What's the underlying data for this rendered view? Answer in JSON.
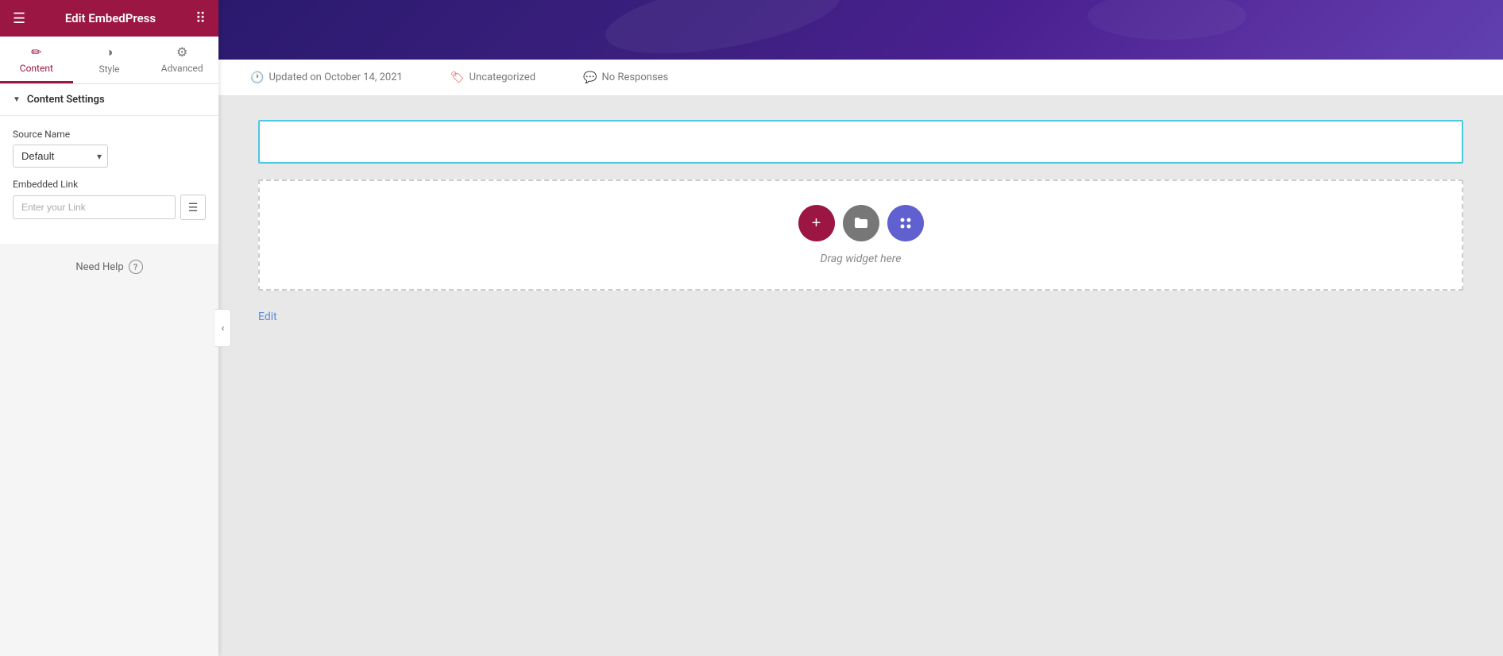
{
  "header": {
    "title": "Edit EmbedPress",
    "hamburger": "☰",
    "grid": "⠿"
  },
  "tabs": [
    {
      "id": "content",
      "label": "Content",
      "icon": "✏️",
      "active": true
    },
    {
      "id": "style",
      "label": "Style",
      "icon": "◑",
      "active": false
    },
    {
      "id": "advanced",
      "label": "Advanced",
      "icon": "⚙",
      "active": false
    }
  ],
  "sections": {
    "content_settings": {
      "title": "Content Settings",
      "source_name_label": "Source Name",
      "source_name_default": "Default",
      "embedded_link_label": "Embedded Link",
      "embedded_link_placeholder": "Enter your Link"
    }
  },
  "need_help": {
    "label": "Need Help",
    "icon": "?"
  },
  "meta_bar": {
    "updated": "Updated on October 14, 2021",
    "category": "Uncategorized",
    "responses": "No Responses"
  },
  "drop_zone": {
    "label": "Drag widget here"
  },
  "edit_link": "Edit",
  "colors": {
    "accent": "#9b1642",
    "blue": "#5b8dd9",
    "cyan": "#4dc8e0",
    "purple": "#6060d0",
    "gray": "#777"
  }
}
